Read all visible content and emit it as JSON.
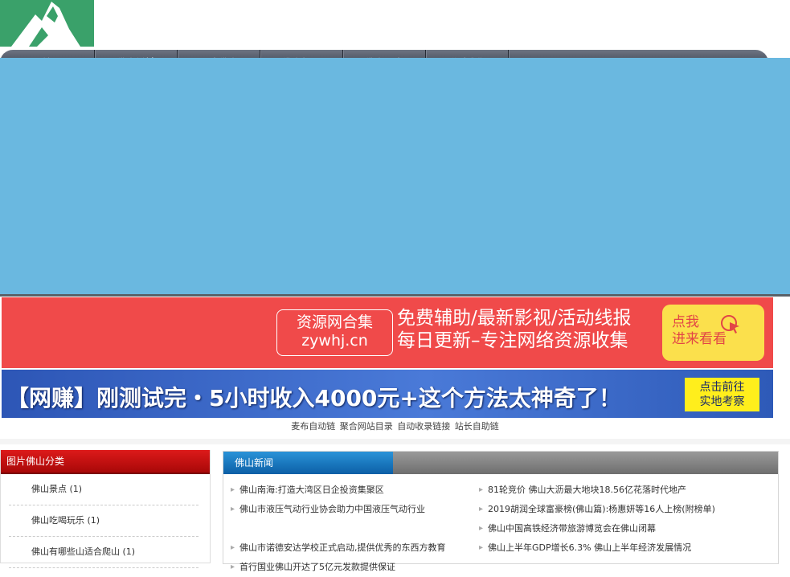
{
  "nav": [
    "首 页",
    "佛山禅城",
    "图片佛山",
    "佛山新闻",
    "佛山历史",
    "联系我们"
  ],
  "ad1": {
    "box_line1": "资源网合集",
    "box_line2": "zywhj.cn",
    "line1": "免费辅助/最新影视/活动线报",
    "line2": "每日更新–专注网络资源收集",
    "btn_line1": "点我",
    "btn_line2": "进来看看"
  },
  "ad2": {
    "headline": "【网赚】刚测试完・5小时收入4000元+这个方法太神奇了！",
    "btn_line1": "点击前往",
    "btn_line2": "实地考察"
  },
  "links": [
    "麦布自动链",
    "聚合网站目录",
    "自动收录链接",
    "站长自助链"
  ],
  "left": {
    "title": "图片佛山分类",
    "items": [
      "佛山景点 (1)",
      "佛山吃喝玩乐 (1)",
      "佛山有哪些山适合爬山 (1)"
    ]
  },
  "right": {
    "tab": "佛山新闻",
    "col1": [
      "佛山南海:打造大湾区日企投资集聚区",
      "佛山市液压气动行业协会助力中国液压气动行业",
      "佛山市诺德安达学校正式启动,提供优秀的东西方教育",
      "首行国业佛山开达了5亿元发款提供保证"
    ],
    "col2": [
      "81轮竞价 佛山大沥最大地块18.56亿花落时代地产",
      "2019胡润全球富豪榜(佛山篇):杨惠妍等16人上榜(附榜单)",
      "佛山中国高铁经济带旅游博览会在佛山闭幕",
      "佛山上半年GDP增长6.3% 佛山上半年经济发展情况"
    ]
  },
  "colors": {
    "logo": "#3aa16a",
    "banner": "#6ab8e0",
    "ad_red": "#f04a4a",
    "ad_blue": "#2d56b6",
    "left_head": "#c80c0c",
    "right_tab": "#1878c0"
  },
  "icons": [
    "mountain-logo-icon",
    "cursor-click-icon",
    "bullet-arrow-icon"
  ]
}
